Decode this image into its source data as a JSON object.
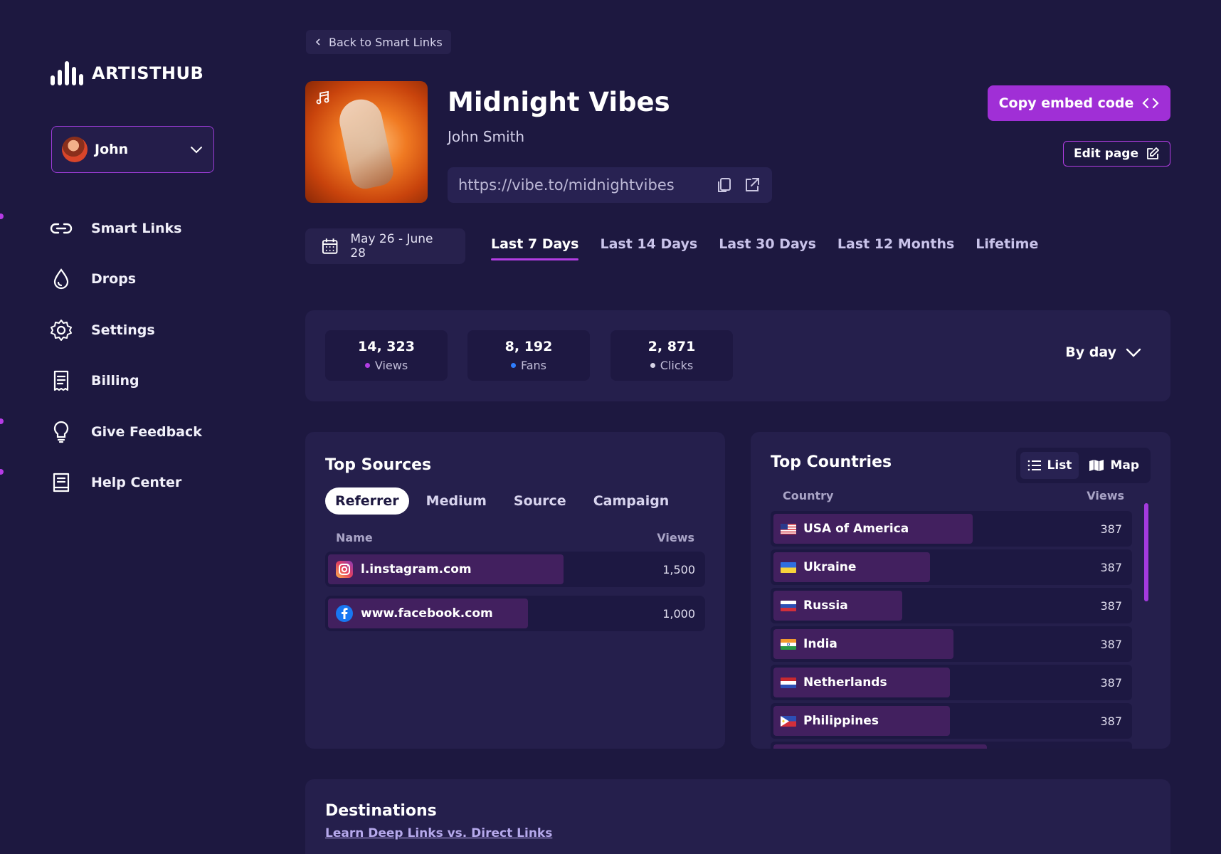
{
  "app": {
    "logo_text": "ARTISTHUB"
  },
  "user": {
    "name": "John"
  },
  "sidebar": {
    "items": [
      {
        "label": "Smart Links",
        "icon": "link-icon"
      },
      {
        "label": "Drops",
        "icon": "drop-icon"
      },
      {
        "label": "Settings",
        "icon": "gear-icon"
      },
      {
        "label": "Billing",
        "icon": "receipt-icon"
      },
      {
        "label": "Give Feedback",
        "icon": "lightbulb-icon"
      },
      {
        "label": "Help Center",
        "icon": "book-icon"
      }
    ]
  },
  "header": {
    "back_label": "Back to Smart Links",
    "title": "Midnight Vibes",
    "artist": "John Smith",
    "url": "https://vibe.to/midnightvibes",
    "embed_label": "Copy embed code",
    "edit_label": "Edit page"
  },
  "date_range": {
    "label": "May 26 - June 28",
    "tabs": [
      "Last 7 Days",
      "Last 14 Days",
      "Last 30 Days",
      "Last 12 Months",
      "Lifetime"
    ],
    "active": "Last 7 Days"
  },
  "stats": {
    "items": [
      {
        "value": "14, 323",
        "label": "Views",
        "color": "#b23de3"
      },
      {
        "value": "8, 192",
        "label": "Fans",
        "color": "#2f7dff"
      },
      {
        "value": "2, 871",
        "label": "Clicks",
        "color": "#d6d3e6"
      }
    ],
    "grouping": "By day"
  },
  "sources": {
    "title": "Top Sources",
    "tabs": [
      "Referrer",
      "Medium",
      "Source",
      "Campaign"
    ],
    "active_tab": "Referrer",
    "columns": [
      "Name",
      "Views"
    ],
    "rows": [
      {
        "name": "l.instagram.com",
        "views": "1,500",
        "icon": "instagram-icon",
        "share": 1.0
      },
      {
        "name": "www.facebook.com",
        "views": "1,000",
        "icon": "facebook-icon",
        "share": 0.67
      }
    ]
  },
  "countries": {
    "title": "Top Countries",
    "view_toggle": [
      "List",
      "Map"
    ],
    "active_view": "List",
    "columns": [
      "Country",
      "Views"
    ],
    "rows": [
      {
        "name": "USA of America",
        "views": "387",
        "flag": "us-flag-icon",
        "share": 0.55
      },
      {
        "name": "Ukraine",
        "views": "387",
        "flag": "ukraine-flag-icon",
        "share": 0.43
      },
      {
        "name": "Russia",
        "views": "387",
        "flag": "russia-flag-icon",
        "share": 0.36
      },
      {
        "name": "India",
        "views": "387",
        "flag": "india-flag-icon",
        "share": 0.5
      },
      {
        "name": "Netherlands",
        "views": "387",
        "flag": "netherlands-flag-icon",
        "share": 0.49
      },
      {
        "name": "Philippines",
        "views": "387",
        "flag": "philippines-flag-icon",
        "share": 0.49
      }
    ]
  },
  "destinations": {
    "title": "Destinations",
    "link": "Learn Deep Links vs. Direct Links"
  }
}
